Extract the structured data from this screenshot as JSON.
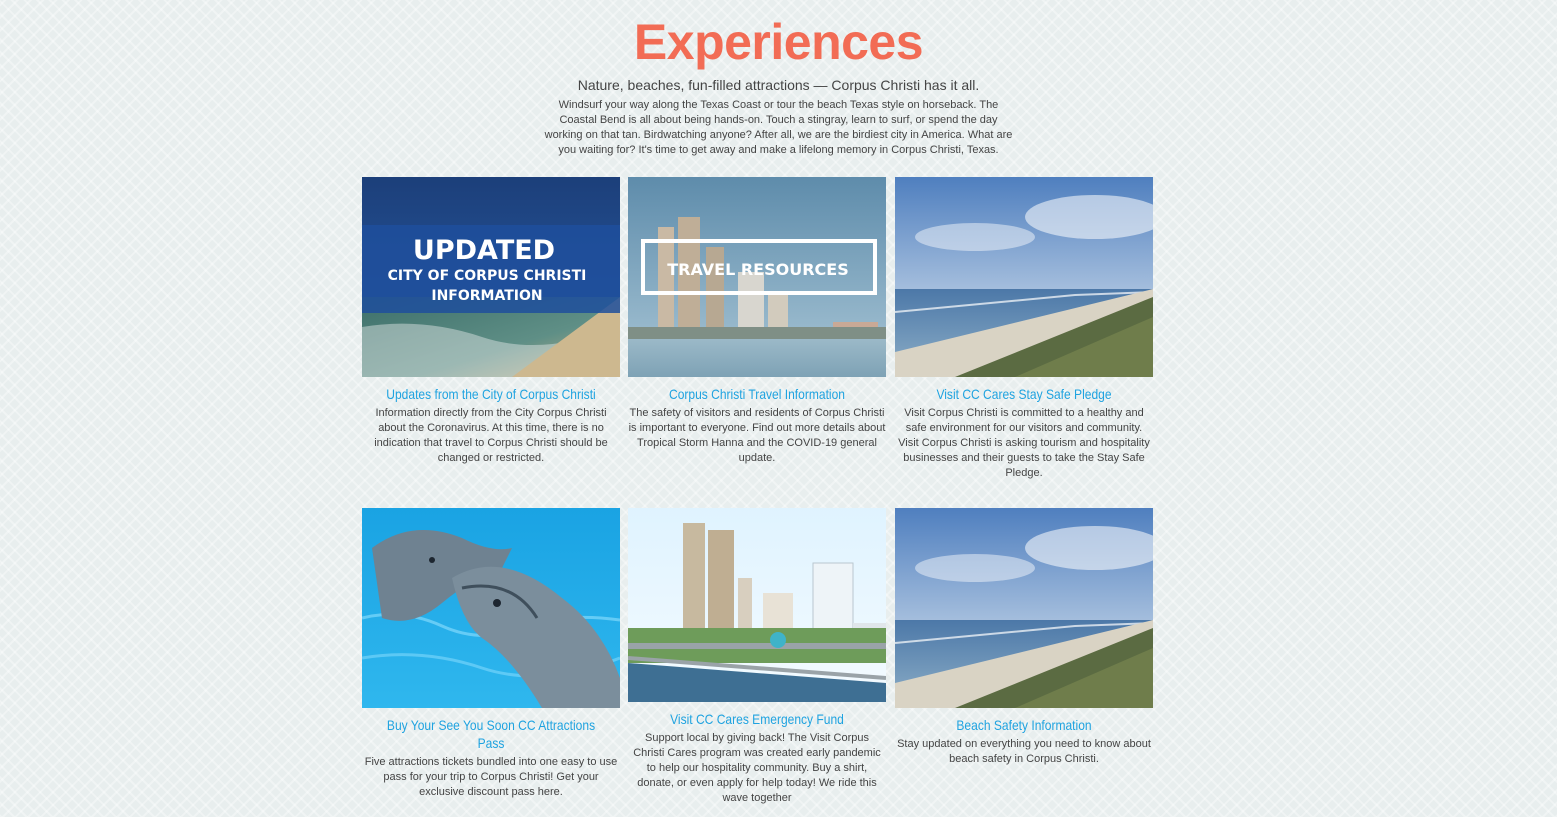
{
  "header": {
    "title": "Experiences",
    "subtitle": "Nature, beaches, fun-filled attractions — Corpus Christi has it all.",
    "intro": "Windsurf your way along the Texas Coast or tour the beach Texas style on horseback. The Coastal Bend is all about being hands-on. Touch a stingray, learn to surf, or spend the day working on that tan. Birdwatching anyone? After all, we are the birdiest city in America. What are you waiting for? It's time to get away and make a lifelong memory in Corpus Christi, Texas."
  },
  "cards": [
    {
      "image_text_1": "UPDATED",
      "image_text_2": "CITY OF CORPUS CHRISTI",
      "image_text_3": "INFORMATION",
      "title": "Updates from the City of Corpus Christi",
      "description": "Information directly from the City Corpus Christi about the Coronavirus. At this time, there is no indication that travel to Corpus Christi should be changed or restricted."
    },
    {
      "image_text_1": "TRAVEL RESOURCES",
      "title": "Corpus Christi Travel Information",
      "description": "The safety of visitors and residents of Corpus Christi is important to everyone. Find out more details about Tropical Storm Hanna and the COVID-19 general update."
    },
    {
      "title": "Visit CC Cares Stay Safe Pledge",
      "description": "Visit Corpus Christi is committed to a healthy and safe environment for our visitors and community. Visit Corpus Christi is asking tourism and hospitality businesses and their guests to take the Stay Safe Pledge."
    },
    {
      "title": "Buy Your See You Soon CC Attractions Pass",
      "description": "Five attractions tickets bundled into one easy to use pass for your trip to Corpus Christi! Get your exclusive discount pass here."
    },
    {
      "title": "Visit CC Cares Emergency Fund",
      "description": "Support local by giving back! The Visit Corpus Christi Cares program was created early pandemic to help our hospitality community. Buy a shirt, donate, or even apply for help today! We ride this wave together"
    },
    {
      "title": "Beach Safety Information",
      "description": "Stay updated on everything you need to know about beach safety in Corpus Christi."
    }
  ],
  "colors": {
    "title": "#f26c55",
    "link": "#1fa3e0",
    "background": "#e8eeee"
  }
}
